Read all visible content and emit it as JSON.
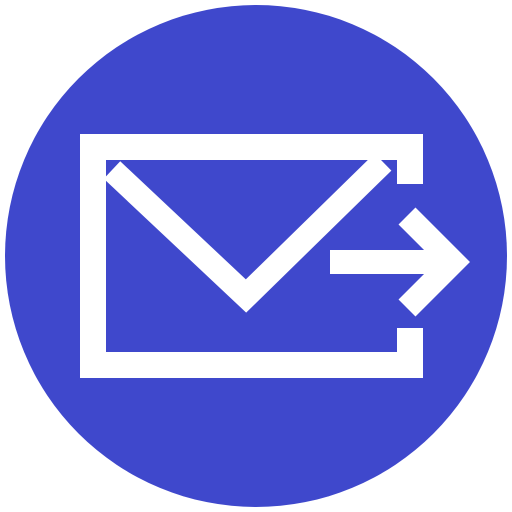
{
  "icon": {
    "name": "send-mail-icon",
    "background_color": "#3f48cc",
    "foreground_color": "#ffffff"
  }
}
